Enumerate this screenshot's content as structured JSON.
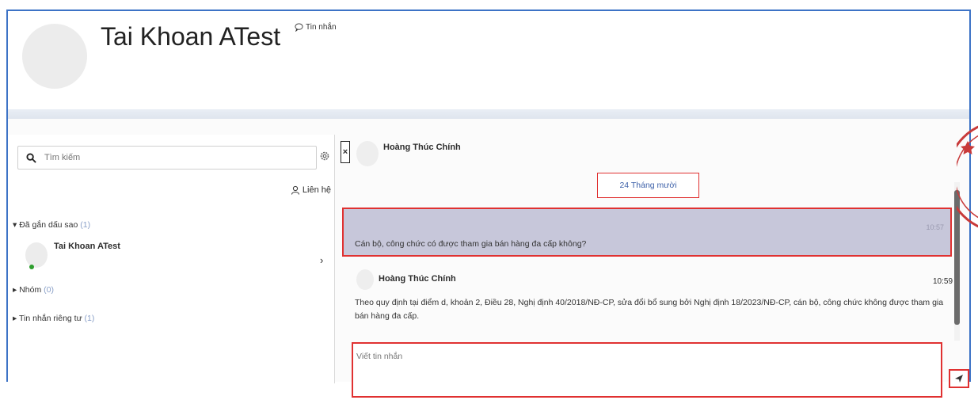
{
  "header": {
    "profile_name": "Tai Khoan ATest",
    "message_link": "Tin nhắn"
  },
  "sidebar": {
    "search_placeholder": "Tìm kiếm",
    "contacts_label": "Liên hệ",
    "sections": [
      {
        "label": "Đã gắn dấu sao",
        "count": "(1)"
      },
      {
        "label": "Nhóm",
        "count": "(0)"
      },
      {
        "label": "Tin nhắn riêng tư",
        "count": "(1)"
      }
    ],
    "conversation": {
      "name": "Tai Khoan ATest"
    }
  },
  "chat": {
    "contact_name": "Hoàng Thúc Chính",
    "date_divider": "24 Tháng mười",
    "question": {
      "text": "Cán bộ, công chức có được tham gia bán hàng đa cấp không?",
      "time": "10:57"
    },
    "reply": {
      "sender": "Hoàng Thúc Chính",
      "time": "10:59",
      "text": "Theo quy định tại điểm d, khoản 2, Điều 28, Nghị định 40/2018/NĐ-CP, sửa đổi bổ sung bởi Nghị định 18/2023/NĐ-CP, cán bộ, công chức không được tham gia bán hàng đa cấp."
    },
    "compose_placeholder": "Viết tin nhắn"
  },
  "colors": {
    "frame_border": "#3d73c6",
    "highlight_red": "#e03131",
    "question_bg": "#c7c7da",
    "online": "#2e9e2e"
  }
}
